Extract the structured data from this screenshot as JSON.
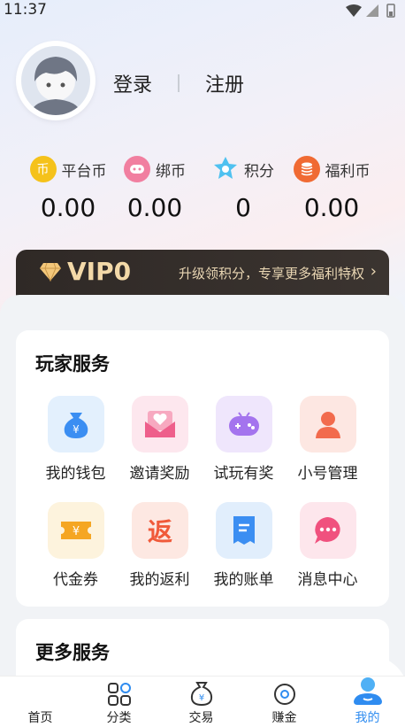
{
  "status_bar": {
    "time": "11:37"
  },
  "profile": {
    "login_label": "登录",
    "register_label": "注册"
  },
  "wallet": [
    {
      "label": "平台币",
      "value": "0.00",
      "icon": "platform-coin-icon",
      "color": "#f5c21b"
    },
    {
      "label": "绑币",
      "value": "0.00",
      "icon": "bind-coin-icon",
      "color": "#f17fa0"
    },
    {
      "label": "积分",
      "value": "0",
      "icon": "points-icon",
      "color": "#4fc1f0"
    },
    {
      "label": "福利币",
      "value": "0.00",
      "icon": "welfare-coin-icon",
      "color": "#f06a33"
    }
  ],
  "vip": {
    "level": "VIP0",
    "description": "升级领积分，专享更多福利特权"
  },
  "player_services": {
    "title": "玩家服务",
    "items": [
      {
        "label": "我的钱包",
        "icon": "wallet-bag-icon"
      },
      {
        "label": "邀请奖励",
        "icon": "invite-envelope-icon"
      },
      {
        "label": "试玩有奖",
        "icon": "game-controller-icon"
      },
      {
        "label": "小号管理",
        "icon": "account-user-icon"
      },
      {
        "label": "代金券",
        "icon": "voucher-ticket-icon"
      },
      {
        "label": "我的返利",
        "icon": "rebate-icon"
      },
      {
        "label": "我的账单",
        "icon": "bill-receipt-icon"
      },
      {
        "label": "消息中心",
        "icon": "message-bubble-icon"
      }
    ]
  },
  "more_services": {
    "title": "更多服务"
  },
  "tabs": [
    {
      "label": "首页",
      "icon": "home-icon"
    },
    {
      "label": "分类",
      "icon": "category-grid-icon"
    },
    {
      "label": "交易",
      "icon": "trade-bag-icon"
    },
    {
      "label": "赚金",
      "icon": "earn-coin-icon"
    },
    {
      "label": "我的",
      "icon": "mine-user-icon",
      "active": true
    }
  ],
  "colors": {
    "accent": "#2f8cf0",
    "vip_gold": "#f3d9a8",
    "vip_bg": "#2f2926"
  }
}
